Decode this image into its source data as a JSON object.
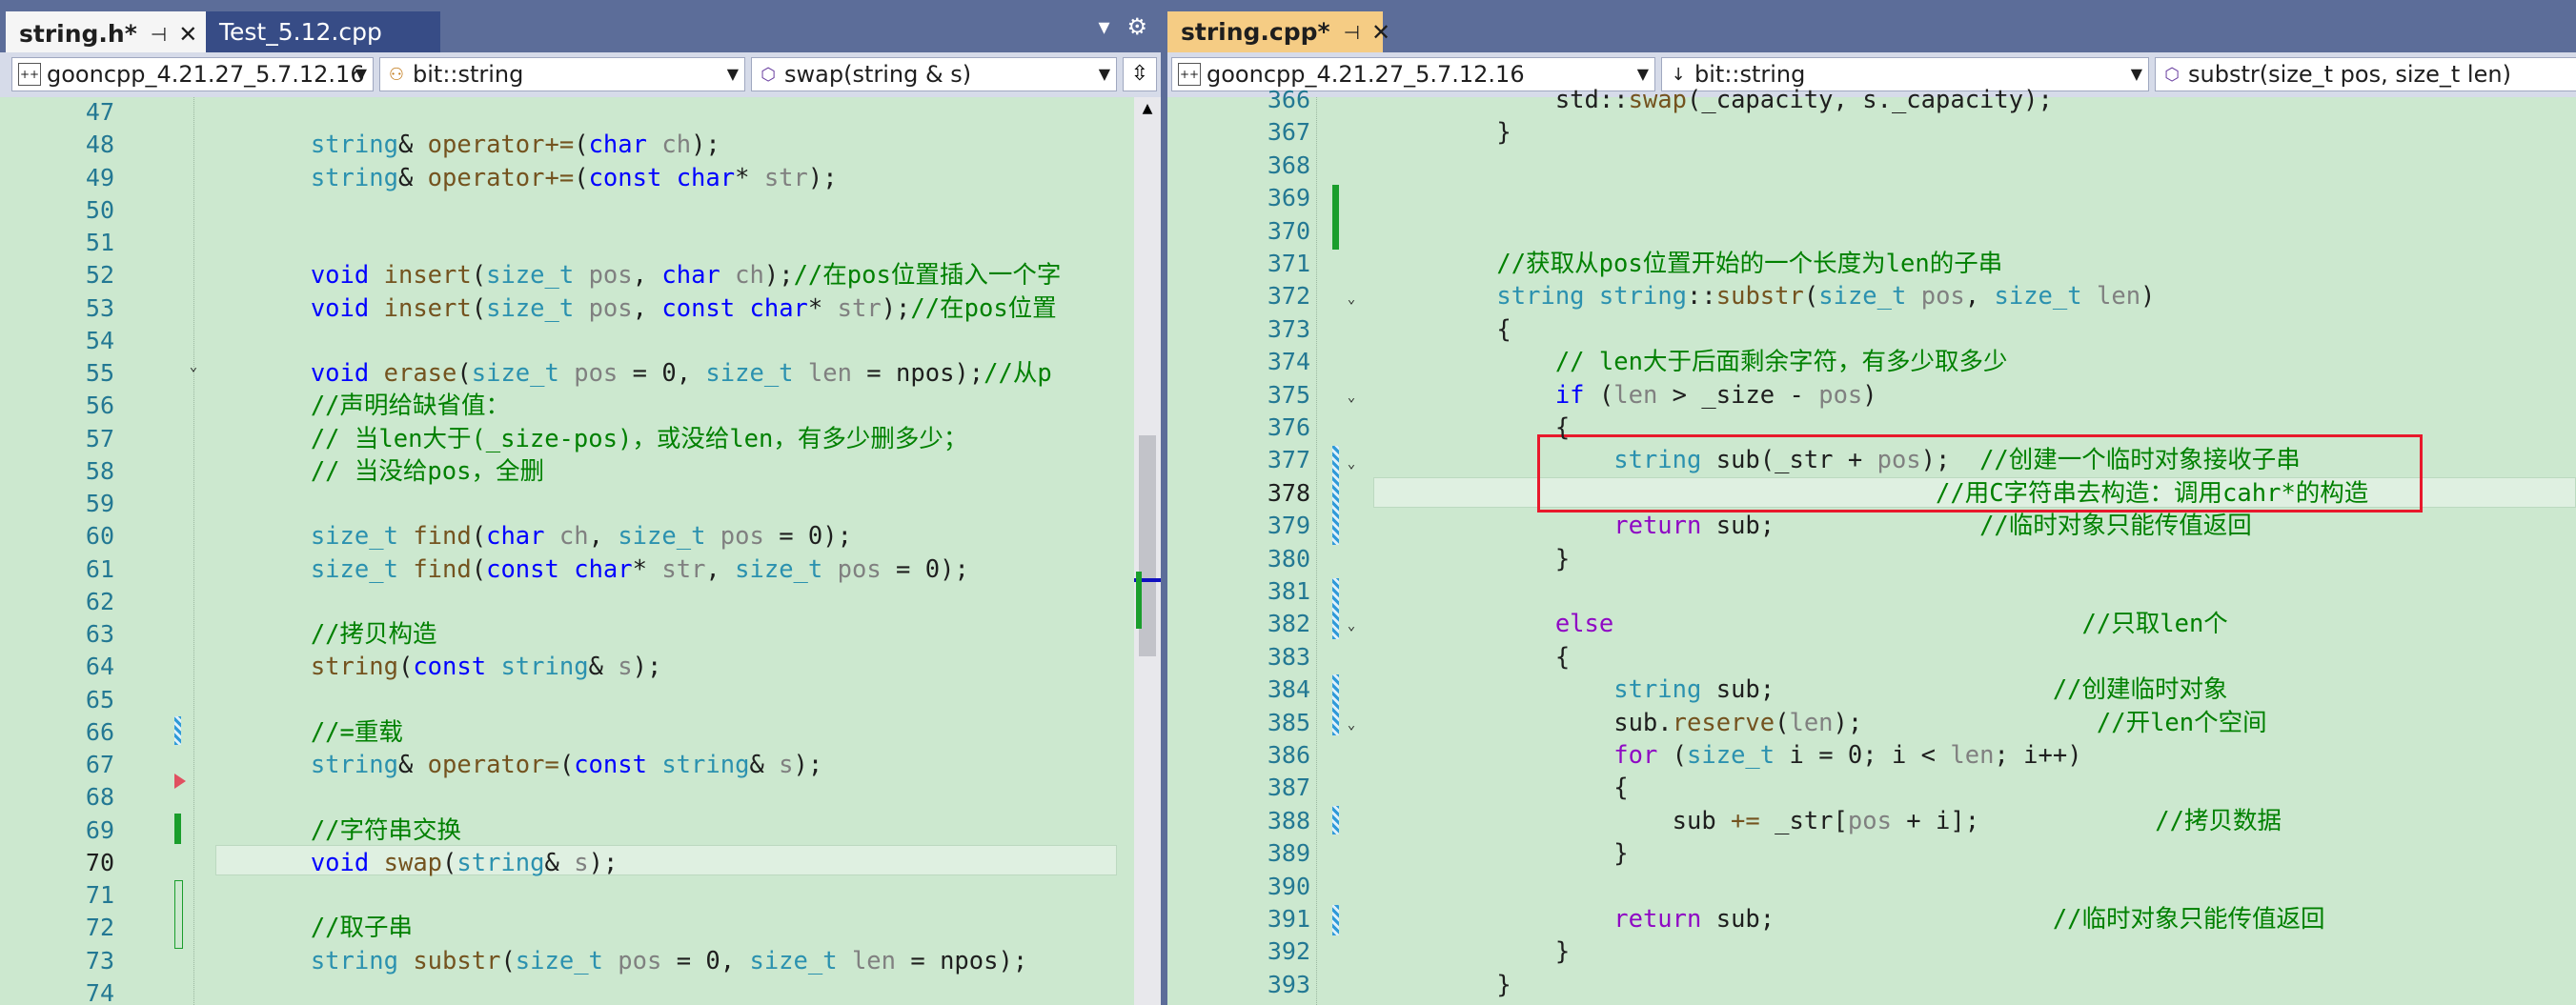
{
  "left": {
    "tabs": [
      {
        "label": "string.h*",
        "active": true
      },
      {
        "label": "Test_5.12.cpp",
        "active": false
      }
    ],
    "nav": {
      "project": "gooncpp_4.21.27_5.7.12.16",
      "scope": "bit::string",
      "member": "swap(string & s)"
    },
    "lines": [
      {
        "n": "47",
        "segs": []
      },
      {
        "n": "48",
        "segs": [
          [
            "        ",
            ""
          ],
          [
            "string",
            "ty"
          ],
          [
            "& ",
            ""
          ],
          [
            "operator+=",
            "fn"
          ],
          [
            "(",
            ""
          ],
          [
            "char",
            "kw"
          ],
          [
            " ",
            ""
          ],
          [
            "ch",
            "pm"
          ],
          [
            ");",
            ""
          ]
        ]
      },
      {
        "n": "49",
        "segs": [
          [
            "        ",
            ""
          ],
          [
            "string",
            "ty"
          ],
          [
            "& ",
            ""
          ],
          [
            "operator+=",
            "fn"
          ],
          [
            "(",
            ""
          ],
          [
            "const",
            "kw"
          ],
          [
            " ",
            ""
          ],
          [
            "char",
            "kw"
          ],
          [
            "* ",
            ""
          ],
          [
            "str",
            "pm"
          ],
          [
            ");",
            ""
          ]
        ]
      },
      {
        "n": "50",
        "segs": []
      },
      {
        "n": "51",
        "segs": []
      },
      {
        "n": "52",
        "segs": [
          [
            "        ",
            ""
          ],
          [
            "void",
            "kw"
          ],
          [
            " ",
            ""
          ],
          [
            "insert",
            "fn"
          ],
          [
            "(",
            ""
          ],
          [
            "size_t",
            "ty"
          ],
          [
            " ",
            ""
          ],
          [
            "pos",
            "pm"
          ],
          [
            ", ",
            ""
          ],
          [
            "char",
            "kw"
          ],
          [
            " ",
            ""
          ],
          [
            "ch",
            "pm"
          ],
          [
            ");",
            ""
          ],
          [
            "//在pos位置插入一个字",
            "cm"
          ]
        ]
      },
      {
        "n": "53",
        "segs": [
          [
            "        ",
            ""
          ],
          [
            "void",
            "kw"
          ],
          [
            " ",
            ""
          ],
          [
            "insert",
            "fn"
          ],
          [
            "(",
            ""
          ],
          [
            "size_t",
            "ty"
          ],
          [
            " ",
            ""
          ],
          [
            "pos",
            "pm"
          ],
          [
            ", ",
            ""
          ],
          [
            "const",
            "kw"
          ],
          [
            " ",
            ""
          ],
          [
            "char",
            "kw"
          ],
          [
            "* ",
            ""
          ],
          [
            "str",
            "pm"
          ],
          [
            ");",
            ""
          ],
          [
            "//在pos位置",
            "cm"
          ]
        ]
      },
      {
        "n": "54",
        "segs": []
      },
      {
        "n": "55",
        "segs": [
          [
            "        ",
            ""
          ],
          [
            "void",
            "kw"
          ],
          [
            " ",
            ""
          ],
          [
            "erase",
            "fn"
          ],
          [
            "(",
            ""
          ],
          [
            "size_t",
            "ty"
          ],
          [
            " ",
            ""
          ],
          [
            "pos",
            "pm"
          ],
          [
            " = 0, ",
            ""
          ],
          [
            "size_t",
            "ty"
          ],
          [
            " ",
            ""
          ],
          [
            "len",
            "pm"
          ],
          [
            " = npos);",
            ""
          ],
          [
            "//从p",
            "cm"
          ]
        ]
      },
      {
        "n": "56",
        "segs": [
          [
            "        ",
            ""
          ],
          [
            "//声明给缺省值：",
            "cm"
          ]
        ]
      },
      {
        "n": "57",
        "segs": [
          [
            "        ",
            ""
          ],
          [
            "// 当len大于(_size-pos)，或没给len，有多少删多少；",
            "cm"
          ]
        ]
      },
      {
        "n": "58",
        "segs": [
          [
            "        ",
            ""
          ],
          [
            "// 当没给pos，全删",
            "cm"
          ]
        ]
      },
      {
        "n": "59",
        "segs": []
      },
      {
        "n": "60",
        "segs": [
          [
            "        ",
            ""
          ],
          [
            "size_t",
            "ty"
          ],
          [
            " ",
            ""
          ],
          [
            "find",
            "fn"
          ],
          [
            "(",
            ""
          ],
          [
            "char",
            "kw"
          ],
          [
            " ",
            ""
          ],
          [
            "ch",
            "pm"
          ],
          [
            ", ",
            ""
          ],
          [
            "size_t",
            "ty"
          ],
          [
            " ",
            ""
          ],
          [
            "pos",
            "pm"
          ],
          [
            " = 0);",
            ""
          ]
        ]
      },
      {
        "n": "61",
        "segs": [
          [
            "        ",
            ""
          ],
          [
            "size_t",
            "ty"
          ],
          [
            " ",
            ""
          ],
          [
            "find",
            "fn"
          ],
          [
            "(",
            ""
          ],
          [
            "const",
            "kw"
          ],
          [
            " ",
            ""
          ],
          [
            "char",
            "kw"
          ],
          [
            "* ",
            ""
          ],
          [
            "str",
            "pm"
          ],
          [
            ", ",
            ""
          ],
          [
            "size_t",
            "ty"
          ],
          [
            " ",
            ""
          ],
          [
            "pos",
            "pm"
          ],
          [
            " = 0);",
            ""
          ]
        ]
      },
      {
        "n": "62",
        "segs": []
      },
      {
        "n": "63",
        "segs": [
          [
            "        ",
            ""
          ],
          [
            "//拷贝构造",
            "cm"
          ]
        ]
      },
      {
        "n": "64",
        "segs": [
          [
            "        ",
            ""
          ],
          [
            "string",
            "fn"
          ],
          [
            "(",
            ""
          ],
          [
            "const",
            "kw"
          ],
          [
            " ",
            ""
          ],
          [
            "string",
            "ty"
          ],
          [
            "& ",
            ""
          ],
          [
            "s",
            "pm"
          ],
          [
            ");",
            ""
          ]
        ]
      },
      {
        "n": "65",
        "segs": []
      },
      {
        "n": "66",
        "segs": [
          [
            "        ",
            ""
          ],
          [
            "//=重载",
            "cm"
          ]
        ]
      },
      {
        "n": "67",
        "segs": [
          [
            "        ",
            ""
          ],
          [
            "string",
            "ty"
          ],
          [
            "& ",
            ""
          ],
          [
            "operator=",
            "fn"
          ],
          [
            "(",
            ""
          ],
          [
            "const",
            "kw"
          ],
          [
            " ",
            ""
          ],
          [
            "string",
            "ty"
          ],
          [
            "& ",
            ""
          ],
          [
            "s",
            "pm"
          ],
          [
            ");",
            ""
          ]
        ]
      },
      {
        "n": "68",
        "segs": []
      },
      {
        "n": "69",
        "segs": [
          [
            "        ",
            ""
          ],
          [
            "//字符串交换",
            "cm"
          ]
        ]
      },
      {
        "n": "70",
        "segs": [
          [
            "        ",
            ""
          ],
          [
            "void",
            "kw"
          ],
          [
            " ",
            ""
          ],
          [
            "swap",
            "fn"
          ],
          [
            "(",
            ""
          ],
          [
            "string",
            "ty"
          ],
          [
            "& ",
            ""
          ],
          [
            "s",
            "pm"
          ],
          [
            ");",
            ""
          ]
        ]
      },
      {
        "n": "71",
        "segs": []
      },
      {
        "n": "72",
        "segs": [
          [
            "        ",
            ""
          ],
          [
            "//取子串",
            "cm"
          ]
        ]
      },
      {
        "n": "73",
        "segs": [
          [
            "        ",
            ""
          ],
          [
            "string",
            "ty"
          ],
          [
            " ",
            ""
          ],
          [
            "substr",
            "fn"
          ],
          [
            "(",
            ""
          ],
          [
            "size_t",
            "ty"
          ],
          [
            " ",
            ""
          ],
          [
            "pos",
            "pm"
          ],
          [
            " = 0, ",
            ""
          ],
          [
            "size_t",
            "ty"
          ],
          [
            " ",
            ""
          ],
          [
            "len",
            "pm"
          ],
          [
            " = npos);",
            ""
          ]
        ]
      },
      {
        "n": "74",
        "segs": []
      }
    ]
  },
  "right": {
    "tabs": [
      {
        "label": "string.cpp*",
        "active": true
      }
    ],
    "nav": {
      "project": "gooncpp_4.21.27_5.7.12.16",
      "scope": "bit::string",
      "member": "substr(size_t pos, size_t len)"
    },
    "lines": [
      {
        "n": "366",
        "segs": [
          [
            "        std::",
            ""
          ],
          [
            "swap",
            "fn"
          ],
          [
            "(_capacity, s._capacity);",
            ""
          ]
        ]
      },
      {
        "n": "367",
        "segs": [
          [
            "    }",
            ""
          ]
        ]
      },
      {
        "n": "368",
        "segs": []
      },
      {
        "n": "369",
        "segs": []
      },
      {
        "n": "370",
        "segs": []
      },
      {
        "n": "371",
        "segs": [
          [
            "    ",
            ""
          ],
          [
            "//获取从pos位置开始的一个长度为len的子串",
            "cm"
          ]
        ]
      },
      {
        "n": "372",
        "segs": [
          [
            "    ",
            ""
          ],
          [
            "string",
            "ty"
          ],
          [
            " ",
            ""
          ],
          [
            "string",
            "ty"
          ],
          [
            "::",
            ""
          ],
          [
            "substr",
            "fn"
          ],
          [
            "(",
            ""
          ],
          [
            "size_t",
            "ty"
          ],
          [
            " ",
            ""
          ],
          [
            "pos",
            "pm"
          ],
          [
            ", ",
            ""
          ],
          [
            "size_t",
            "ty"
          ],
          [
            " ",
            ""
          ],
          [
            "len",
            "pm"
          ],
          [
            ")",
            ""
          ]
        ]
      },
      {
        "n": "373",
        "segs": [
          [
            "    {",
            ""
          ]
        ]
      },
      {
        "n": "374",
        "segs": [
          [
            "        ",
            ""
          ],
          [
            "// len大于后面剩余字符，有多少取多少",
            "cm"
          ]
        ]
      },
      {
        "n": "375",
        "segs": [
          [
            "        ",
            ""
          ],
          [
            "if",
            "kw"
          ],
          [
            " (",
            ""
          ],
          [
            "len",
            "pm"
          ],
          [
            " > _size - ",
            ""
          ],
          [
            "pos",
            "pm"
          ],
          [
            ")",
            ""
          ]
        ]
      },
      {
        "n": "376",
        "segs": [
          [
            "        {",
            ""
          ]
        ]
      },
      {
        "n": "377",
        "segs": [
          [
            "            ",
            ""
          ],
          [
            "string",
            "ty"
          ],
          [
            " sub(_str + ",
            ""
          ],
          [
            "pos",
            "pm"
          ],
          [
            ");  ",
            ""
          ],
          [
            "//创建一个临时对象接收子串",
            "cm"
          ]
        ]
      },
      {
        "n": "378",
        "segs": [
          [
            "                                  ",
            ""
          ],
          [
            "//用C字符串去构造：调用cahr*的构造",
            "cm"
          ]
        ]
      },
      {
        "n": "379",
        "segs": [
          [
            "            ",
            ""
          ],
          [
            "return",
            "mac"
          ],
          [
            " sub;              ",
            ""
          ],
          [
            "//临时对象只能传值返回",
            "cm"
          ]
        ]
      },
      {
        "n": "380",
        "segs": [
          [
            "        }",
            ""
          ]
        ]
      },
      {
        "n": "381",
        "segs": []
      },
      {
        "n": "382",
        "segs": [
          [
            "        ",
            ""
          ],
          [
            "else",
            "mac"
          ],
          [
            "                                ",
            ""
          ],
          [
            "//只取len个",
            "cm"
          ]
        ]
      },
      {
        "n": "383",
        "segs": [
          [
            "        {",
            ""
          ]
        ]
      },
      {
        "n": "384",
        "segs": [
          [
            "            ",
            ""
          ],
          [
            "string",
            "ty"
          ],
          [
            " sub;                   ",
            ""
          ],
          [
            "//创建临时对象",
            "cm"
          ]
        ]
      },
      {
        "n": "385",
        "segs": [
          [
            "            sub.",
            ""
          ],
          [
            "reserve",
            "fn"
          ],
          [
            "(",
            ""
          ],
          [
            "len",
            "pm"
          ],
          [
            ");                ",
            ""
          ],
          [
            "//开len个空间",
            "cm"
          ]
        ]
      },
      {
        "n": "386",
        "segs": [
          [
            "            ",
            ""
          ],
          [
            "for",
            "mac"
          ],
          [
            " (",
            ""
          ],
          [
            "size_t",
            "ty"
          ],
          [
            " i = 0; i < ",
            ""
          ],
          [
            "len",
            "pm"
          ],
          [
            "; i++)",
            ""
          ]
        ]
      },
      {
        "n": "387",
        "segs": [
          [
            "            {",
            ""
          ]
        ]
      },
      {
        "n": "388",
        "segs": [
          [
            "                sub ",
            ""
          ],
          [
            "+=",
            "fn"
          ],
          [
            " _str[",
            ""
          ],
          [
            "pos",
            "pm"
          ],
          [
            " + i];            ",
            ""
          ],
          [
            "//拷贝数据",
            "cm"
          ]
        ]
      },
      {
        "n": "389",
        "segs": [
          [
            "            }",
            ""
          ]
        ]
      },
      {
        "n": "390",
        "segs": []
      },
      {
        "n": "391",
        "segs": [
          [
            "            ",
            ""
          ],
          [
            "return",
            "mac"
          ],
          [
            " sub;                   ",
            ""
          ],
          [
            "//临时对象只能传值返回",
            "cm"
          ]
        ]
      },
      {
        "n": "392",
        "segs": [
          [
            "        }",
            ""
          ]
        ]
      },
      {
        "n": "393",
        "segs": [
          [
            "    }",
            ""
          ]
        ]
      }
    ]
  },
  "current_line_left": "70",
  "current_line_right": "378",
  "colors": {
    "editor_bg": "#cce8cf",
    "accent_tab": "#f5cc84",
    "frame": "#5c6d99"
  }
}
